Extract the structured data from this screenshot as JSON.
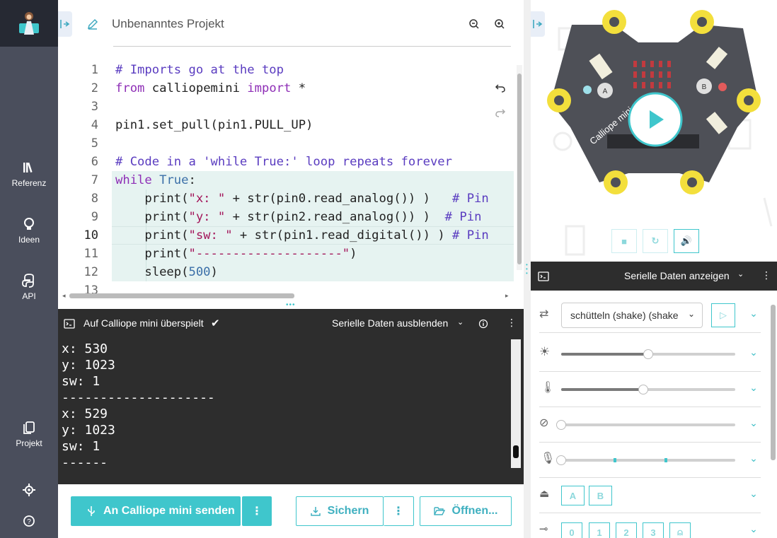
{
  "project": {
    "title": "Unbenanntes Projekt"
  },
  "sidebar": {
    "items": [
      {
        "label": "Referenz",
        "icon": "library-icon"
      },
      {
        "label": "Ideen",
        "icon": "lightbulb-icon"
      },
      {
        "label": "API",
        "icon": "python-icon"
      },
      {
        "label": "Projekt",
        "icon": "copy-icon"
      }
    ]
  },
  "editor": {
    "active_line": "10",
    "line_numbers": [
      "1",
      "2",
      "3",
      "4",
      "5",
      "6",
      "7",
      "8",
      "9",
      "10",
      "11",
      "12",
      "13"
    ],
    "lines": [
      [
        {
          "t": "cm",
          "v": "# Imports go at the top"
        }
      ],
      [
        {
          "t": "kw",
          "v": "from"
        },
        {
          "t": "nm",
          "v": " calliopemini "
        },
        {
          "t": "kw",
          "v": "import"
        },
        {
          "t": "nm",
          "v": " *"
        }
      ],
      [],
      [
        {
          "t": "nm",
          "v": "pin1.set_pull(pin1.PULL_UP)"
        }
      ],
      [],
      [
        {
          "t": "cm",
          "v": "# Code in a 'while True:' loop repeats forever"
        }
      ],
      [
        {
          "t": "kw",
          "v": "while"
        },
        {
          "t": "nm",
          "v": " "
        },
        {
          "t": "bi",
          "v": "True"
        },
        {
          "t": "nm",
          "v": ":"
        }
      ],
      [
        {
          "t": "nm",
          "v": "    print("
        },
        {
          "t": "st",
          "v": "\"x: \""
        },
        {
          "t": "nm",
          "v": " + str(pin0.read_analog()) )   "
        },
        {
          "t": "cm",
          "v": "# Pin"
        }
      ],
      [
        {
          "t": "nm",
          "v": "    print("
        },
        {
          "t": "st",
          "v": "\"y: \""
        },
        {
          "t": "nm",
          "v": " + str(pin2.read_analog()) )  "
        },
        {
          "t": "cm",
          "v": "# Pin"
        }
      ],
      [
        {
          "t": "nm",
          "v": "    print("
        },
        {
          "t": "st",
          "v": "\"sw: \""
        },
        {
          "t": "nm",
          "v": " + str(pin1.read_digital()) ) "
        },
        {
          "t": "cm",
          "v": "# Pin"
        }
      ],
      [
        {
          "t": "nm",
          "v": "    print("
        },
        {
          "t": "st",
          "v": "\"--------------------\""
        },
        {
          "t": "nm",
          "v": ")"
        }
      ],
      [
        {
          "t": "nm",
          "v": "    sleep("
        },
        {
          "t": "bi",
          "v": "500"
        },
        {
          "t": "nm",
          "v": ")"
        }
      ],
      []
    ]
  },
  "console": {
    "status": "Auf Calliope mini überspielt",
    "hide_label": "Serielle Daten ausblenden",
    "output": [
      "x: 530",
      "y: 1023",
      "sw: 1",
      "--------------------",
      "x: 529",
      "y: 1023",
      "sw: 1",
      "------"
    ]
  },
  "bottom": {
    "send_label": "An Calliope mini senden",
    "save_label": "Sichern",
    "open_label": "Öffnen..."
  },
  "sim": {
    "serial_label": "Serielle Daten anzeigen",
    "gesture_value": "schütteln (shake) (shake",
    "buttons_ab": [
      "A",
      "B"
    ],
    "pins": [
      "0",
      "1",
      "2",
      "3"
    ],
    "board_button_a": "A",
    "board_button_b": "B",
    "board_brand": "Calliope mini",
    "light_level": 0.5,
    "temperature_level": 0.47,
    "compass_level": 0.0,
    "sound_level": 0.0
  },
  "colors": {
    "accent": "#3fc6cc",
    "sidebar": "#4a4e5c",
    "console": "#2d2d2d"
  }
}
